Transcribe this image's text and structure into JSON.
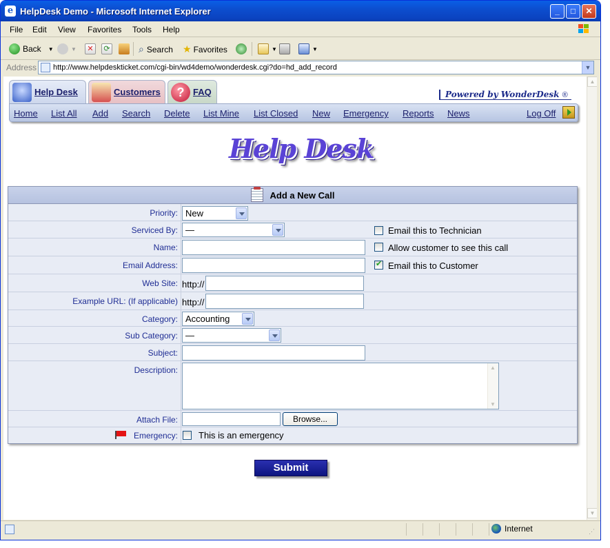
{
  "window": {
    "title": "HelpDesk Demo - Microsoft Internet Explorer"
  },
  "menu": [
    "File",
    "Edit",
    "View",
    "Favorites",
    "Tools",
    "Help"
  ],
  "toolbar": {
    "back": "Back",
    "search": "Search",
    "favorites": "Favorites"
  },
  "address": {
    "label": "Address",
    "url": "http://www.helpdeskticket.com/cgi-bin/wd4demo/wonderdesk.cgi?do=hd_add_record"
  },
  "tabs": [
    {
      "label": "Help Desk",
      "icon": "helpdesk-icon"
    },
    {
      "label": "Customers",
      "icon": "customers-icon"
    },
    {
      "label": "FAQ",
      "icon": "faq-icon"
    }
  ],
  "powered": {
    "text": "Powered by WonderDesk",
    "reg": "®"
  },
  "nav": [
    "Home",
    "List All",
    "Add",
    "Search",
    "Delete",
    "List Mine",
    "List Closed",
    "New",
    "Emergency",
    "Reports",
    "News",
    "Log Off"
  ],
  "logo": "Help Desk",
  "form": {
    "header": "Add a New Call",
    "priority": {
      "label": "Priority:",
      "value": "New"
    },
    "serviced_by": {
      "label": "Serviced By:",
      "value": "—"
    },
    "name": {
      "label": "Name:"
    },
    "email": {
      "label": "Email Address:"
    },
    "website": {
      "label": "Web Site:",
      "prefix": "http://"
    },
    "example_url": {
      "label": "Example URL: (If applicable)",
      "prefix": "http://"
    },
    "category": {
      "label": "Category:",
      "value": "Accounting"
    },
    "sub_category": {
      "label": "Sub Category:",
      "value": "—"
    },
    "subject": {
      "label": "Subject:"
    },
    "description": {
      "label": "Description:"
    },
    "attach": {
      "label": "Attach File:",
      "browse": "Browse..."
    },
    "emergency": {
      "label": "Emergency:",
      "checkbox_label": "This is an emergency",
      "checked": false
    },
    "options": [
      {
        "label": "Email this to Technician",
        "checked": false
      },
      {
        "label": "Allow customer to see this call",
        "checked": false
      },
      {
        "label": "Email this to Customer",
        "checked": true
      }
    ],
    "submit": "Submit"
  },
  "status": {
    "zone": "Internet"
  }
}
